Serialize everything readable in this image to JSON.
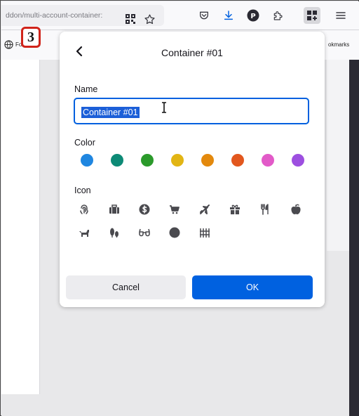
{
  "browser": {
    "url": "ddon/multi-account-container:",
    "bookmarks_left": "Foxtel: Vc",
    "bookmarks_right": "okmarks"
  },
  "step_badge": "3",
  "panel": {
    "title": "Container #01",
    "name_label": "Name",
    "name_value": "Container #01",
    "color_label": "Color",
    "colors": [
      "#1f86e0",
      "#0d8a76",
      "#2b9a2b",
      "#e2b514",
      "#e3890d",
      "#e2571e",
      "#e25ac8",
      "#9d4fe0"
    ],
    "icon_label": "Icon",
    "icons_row1": [
      "fingerprint-icon",
      "briefcase-icon",
      "dollar-icon",
      "cart-icon",
      "vacation-icon",
      "gift-icon",
      "food-icon",
      "fruit-icon"
    ],
    "icons_row2": [
      "pet-icon",
      "tree-icon",
      "chill-icon",
      "circle-icon",
      "fence-icon"
    ],
    "cancel_label": "Cancel",
    "ok_label": "OK"
  }
}
